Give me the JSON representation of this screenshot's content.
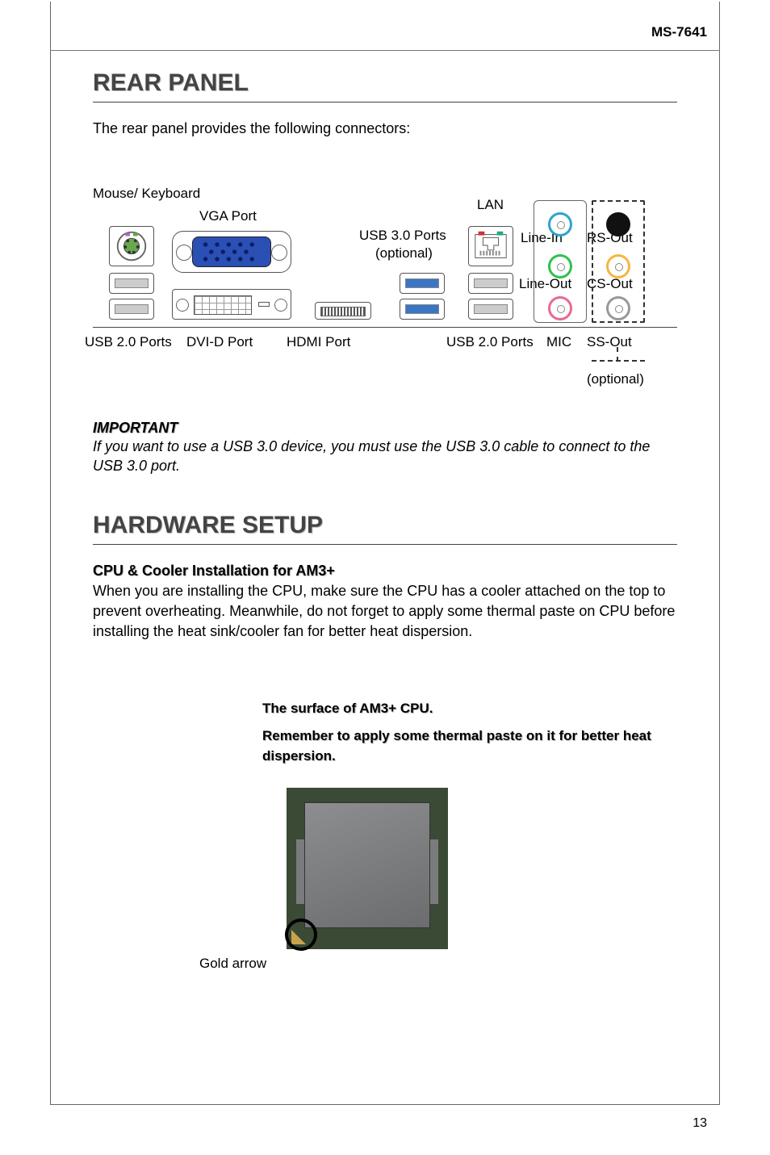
{
  "doc_code": "MS-7641",
  "page_number": "13",
  "section1": {
    "title": "REAR PANEL",
    "intro": "The rear panel provides the following connectors:",
    "labels": {
      "mouse_kb": "Mouse/ Keyboard",
      "vga": "VGA Port",
      "usb3": "USB 3.0 Ports",
      "usb3_opt": "(optional)",
      "lan": "LAN",
      "line_in": "Line-In",
      "line_out": "Line-Out",
      "rs_out": "RS-Out",
      "cs_out": "CS-Out",
      "usb2_left": "USB 2.0 Ports",
      "dvi": "DVI-D Port",
      "hdmi": "HDMI Port",
      "usb2_right": "USB 2.0 Ports",
      "mic": "MIC",
      "ss_out": "SS-Out",
      "optional": "(optional)"
    },
    "important_h": "IMPORTANT",
    "important_p": "If you want to use a USB 3.0 device, you must use the USB 3.0 cable to connect to the USB 3.0 port."
  },
  "section2": {
    "title": "HARDWARE SETUP",
    "sub_h": "CPU & Cooler Installation for AM3+",
    "body": "When you are installing the CPU, make sure the CPU has a cooler attached on the top to prevent overheating. Meanwhile, do not forget to apply some thermal paste on CPU before installing the heat sink/cooler fan for better heat dispersion.",
    "cpu_caption_1": "The surface of AM3+ CPU.",
    "cpu_caption_2": "Remember to apply some thermal paste on it for better heat dispersion.",
    "gold_arrow": "Gold arrow"
  }
}
